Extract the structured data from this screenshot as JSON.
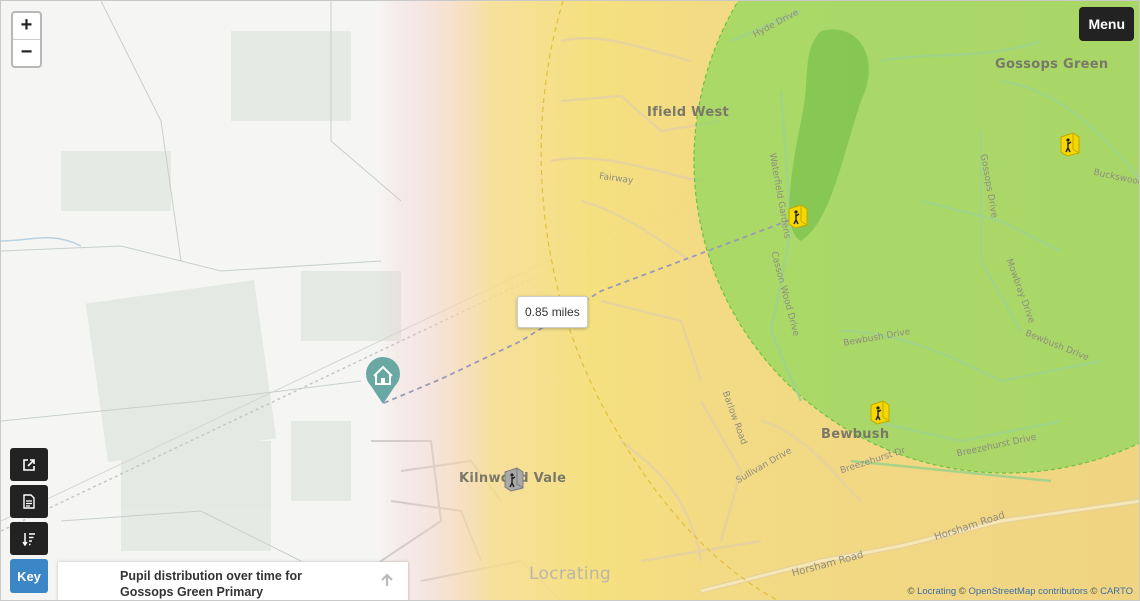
{
  "controls": {
    "zoom_in": "+",
    "zoom_out": "−",
    "menu_label": "Menu",
    "key_label": "Key"
  },
  "tools": [
    {
      "name": "open-external-icon"
    },
    {
      "name": "document-icon"
    },
    {
      "name": "sort-descending-icon"
    }
  ],
  "distribution_panel": {
    "title": "Pupil distribution over time for Gossops Green Primary",
    "icon": "arrow-up-icon"
  },
  "distance_tooltip": "0.85 miles",
  "attribution": {
    "locrating": "Locrating",
    "osm": "OpenStreetMap contributors",
    "carto": "CARTO"
  },
  "places": {
    "gossops_green": "Gossops Green",
    "ifield_west": "Ifield West",
    "bewbush": "Bewbush",
    "kilnwood_vale": "Kilnwood Vale",
    "watermark": "Locrating"
  },
  "streets": {
    "hyde_drive": "Hyde Drive",
    "fairway": "Fairway",
    "waterfield_gardens": "Waterfield Gardens",
    "casson_wood": "Casson Wood Drive",
    "bewbush_drive_1": "Bewbush Drive",
    "bewbush_drive_2": "Bewbush Drive",
    "gossops_drive": "Gossops Drive",
    "buckswood": "Buckswood",
    "mowbray_drive": "Mowbray Drive",
    "barlow_road": "Barlow Road",
    "sullivan_drive": "Sullivan Drive",
    "breezehurst_dr_1": "Breezehurst Dr",
    "breezehurst_dr_2": "Breezehurst Drive",
    "horsham_road_1": "Horsham Road",
    "horsham_road_2": "Horsham Road"
  },
  "colors": {
    "catchment_green": "#7ed957",
    "gradient_yellow": "#f5d96b",
    "gradient_red": "#f3a8a8",
    "home_marker": "#6aa8a4",
    "school_marker": "#f5d800",
    "key_button": "#3b86c6"
  }
}
